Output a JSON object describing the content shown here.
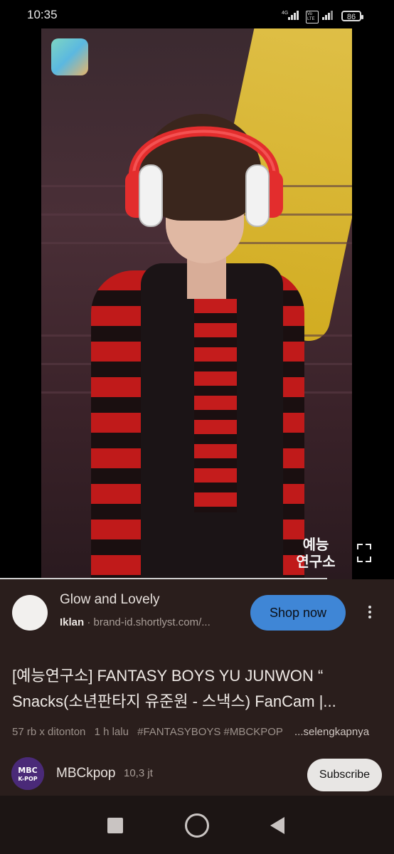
{
  "status_bar": {
    "time": "10:35",
    "net1": "4G",
    "net2": "Vo LTE",
    "battery": "86"
  },
  "video": {
    "progress_percent": 83,
    "logo_bottom_right": "예능\n연구소"
  },
  "ad": {
    "title": "Glow and Lovely",
    "label": "Iklan",
    "url": "brand-id.shortlyst.com/...",
    "cta": "Shop now"
  },
  "info": {
    "title": "[예능연구소] FANTASY BOYS YU JUNWON “ Snacks(소년판타지 유준원 - 스낵스) FanCam |...",
    "views": "57 rb x ditonton",
    "time_ago": "1 h lalu",
    "tags": "#FANTASYBOYS  #MBCKPOP",
    "more": "...selengkapnya"
  },
  "channel": {
    "avatar_text": "MBC K-POP",
    "name": "MBCkpop",
    "subscribers": "10,3 jt",
    "subscribe": "Subscribe"
  },
  "nav": {
    "icons": [
      "recents-square-icon",
      "home-circle-icon",
      "back-triangle-icon"
    ]
  }
}
